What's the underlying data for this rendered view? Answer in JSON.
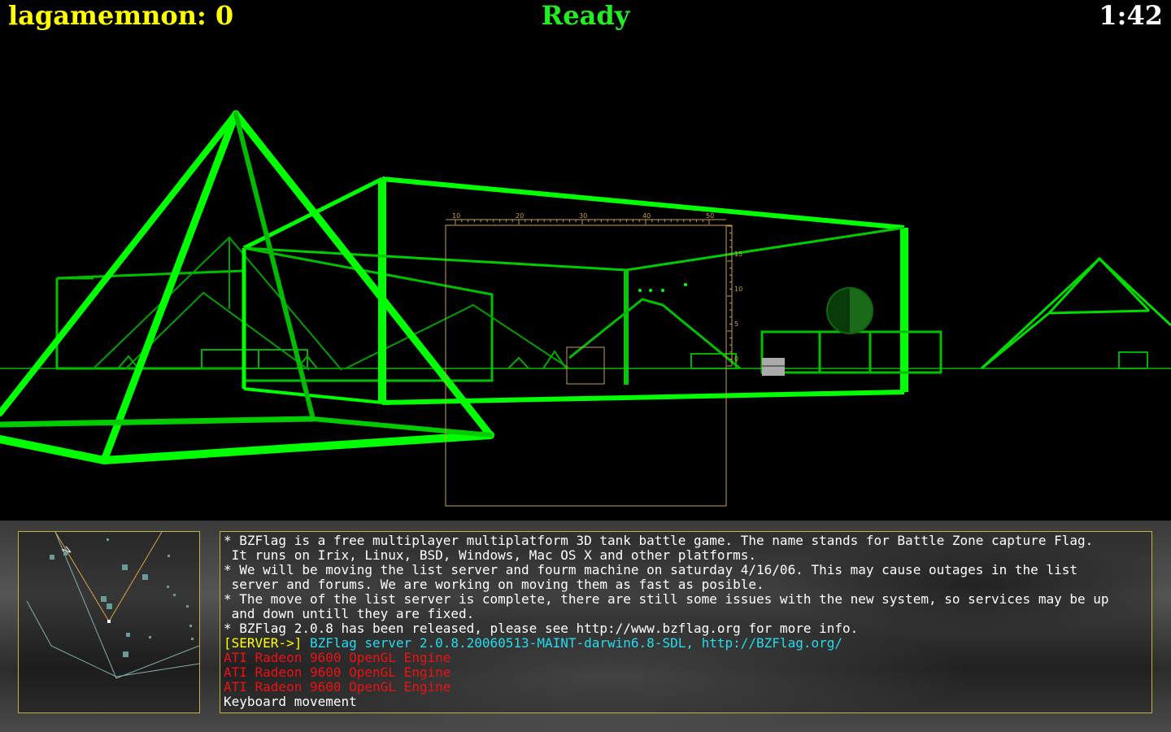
{
  "hud": {
    "score": "lagamemnon: 0",
    "status": "Ready",
    "clock": "1:42"
  },
  "scope": {
    "x_ticks": [
      "10",
      "20",
      "30",
      "40",
      "50"
    ],
    "y_ticks": [
      "15",
      "10",
      "5",
      "0"
    ]
  },
  "radar": {
    "north_label": "N"
  },
  "console": {
    "lines": [
      "* BZFlag is a free multiplayer multiplatform 3D tank battle game. The name stands for Battle Zone capture Flag.",
      " It runs on Irix, Linux, BSD, Windows, Mac OS X and other platforms.",
      "* We will be moving the list server and fourm machine on saturday 4/16/06. This may cause outages in the list",
      " server and forums. We are working on moving them as fast as posible.",
      "* The move of the list server is complete, there are still some issues with the new system, so services may be up",
      " and down untill they are fixed.",
      "* BZFlag 2.0.8 has been released, please see http://www.bzflag.org for more info."
    ],
    "server_tag": "[SERVER->]",
    "server_msg": " BZFlag server 2.0.8.20060513-MAINT-darwin6.8-SDL, http://BZFlag.org/",
    "engine_lines": [
      "ATI Radeon 9600 OpenGL Engine",
      "ATI Radeon 9600 OpenGL Engine",
      "ATI Radeon 9600 OpenGL Engine"
    ],
    "last_line": "Keyboard movement"
  },
  "colors": {
    "wireframe": "#00ff00",
    "score": "#ffff00",
    "status": "#22ee22",
    "scope": "#c8a050",
    "server_tag": "#ffff00",
    "server_msg": "#22ddee",
    "error": "#ee1111"
  }
}
